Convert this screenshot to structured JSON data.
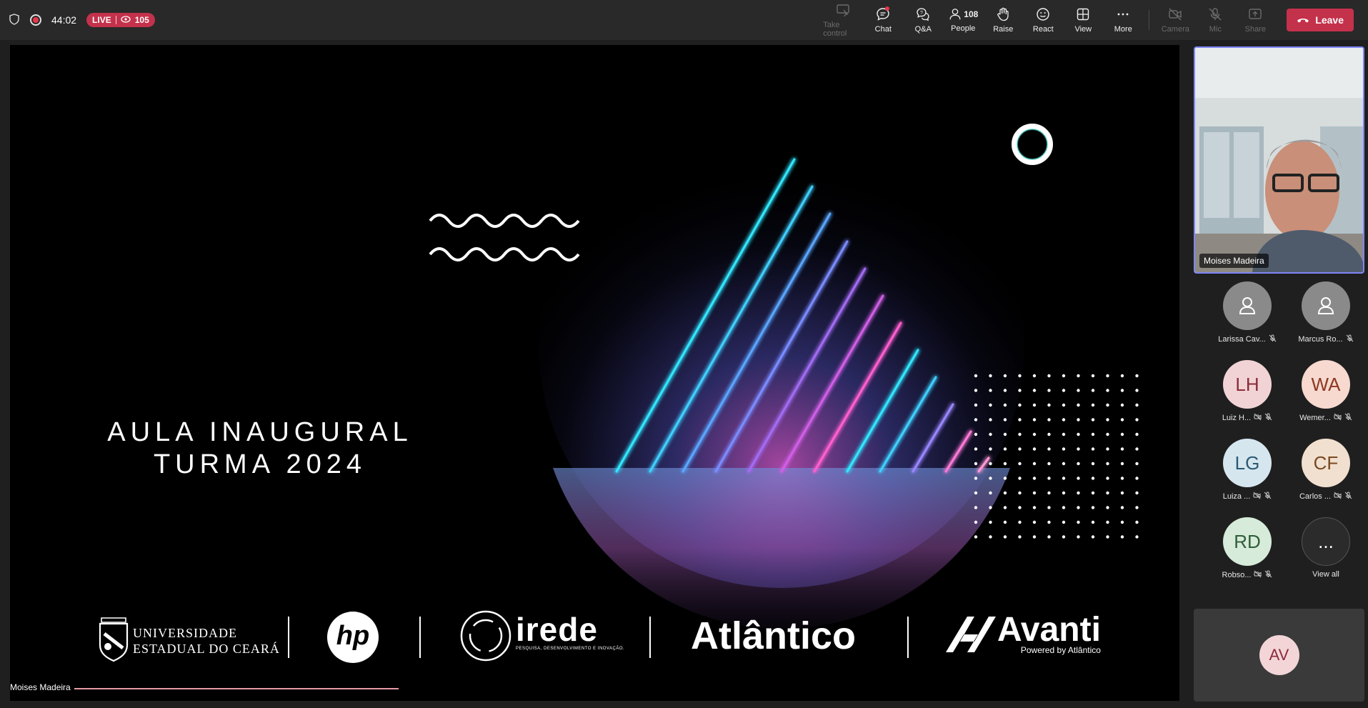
{
  "topbar": {
    "timer": "44:02",
    "live_label": "LIVE",
    "viewer_count": "105",
    "buttons": {
      "take_control": "Take control",
      "chat": "Chat",
      "qa": "Q&A",
      "people_count": "108",
      "people": "People",
      "raise": "Raise",
      "react": "React",
      "view": "View",
      "more": "More",
      "camera": "Camera",
      "mic": "Mic",
      "share": "Share",
      "leave": "Leave"
    }
  },
  "slide": {
    "title_line1": "AULA INAUGURAL",
    "title_line2": "TURMA 2024",
    "logos": {
      "uece_line1": "UNIVERSIDADE",
      "uece_line2": "ESTADUAL DO CEARÁ",
      "hp": "hp",
      "irede": "irede",
      "irede_tagline": "PESQUISA, DESENVOLVIMENTO E INOVAÇÃO.",
      "atlantico": "Atlântico",
      "avanti": "Avanti",
      "avanti_tagline": "Powered by Atlântico"
    },
    "presenter_name": "Moises Madeira"
  },
  "side": {
    "self_name": "Moises Madeira",
    "participants": [
      {
        "initials": "",
        "name": "Larissa Cav...",
        "bg": "#8a8a8a",
        "fg": "#ffffff"
      },
      {
        "initials": "",
        "name": "Marcus Ro...",
        "bg": "#8a8a8a",
        "fg": "#ffffff"
      },
      {
        "initials": "LH",
        "name": "Luiz H...",
        "bg": "#f1d3d6",
        "fg": "#8b2b3a"
      },
      {
        "initials": "WA",
        "name": "Wemer...",
        "bg": "#f7d9cf",
        "fg": "#8a3a22"
      },
      {
        "initials": "LG",
        "name": "Luiza ...",
        "bg": "#d6e6ef",
        "fg": "#2c5a73"
      },
      {
        "initials": "CF",
        "name": "Carlos ...",
        "bg": "#f1e0cf",
        "fg": "#7a4a22"
      },
      {
        "initials": "RD",
        "name": "Robso...",
        "bg": "#d6ebd9",
        "fg": "#2f5e37"
      },
      {
        "initials": "...",
        "name": "View all",
        "bg": "#2b2b2b",
        "fg": "#ffffff"
      }
    ],
    "bottom_initials": "AV",
    "bottom_bg": "#f3d5d8",
    "bottom_fg": "#8b2b3a"
  }
}
